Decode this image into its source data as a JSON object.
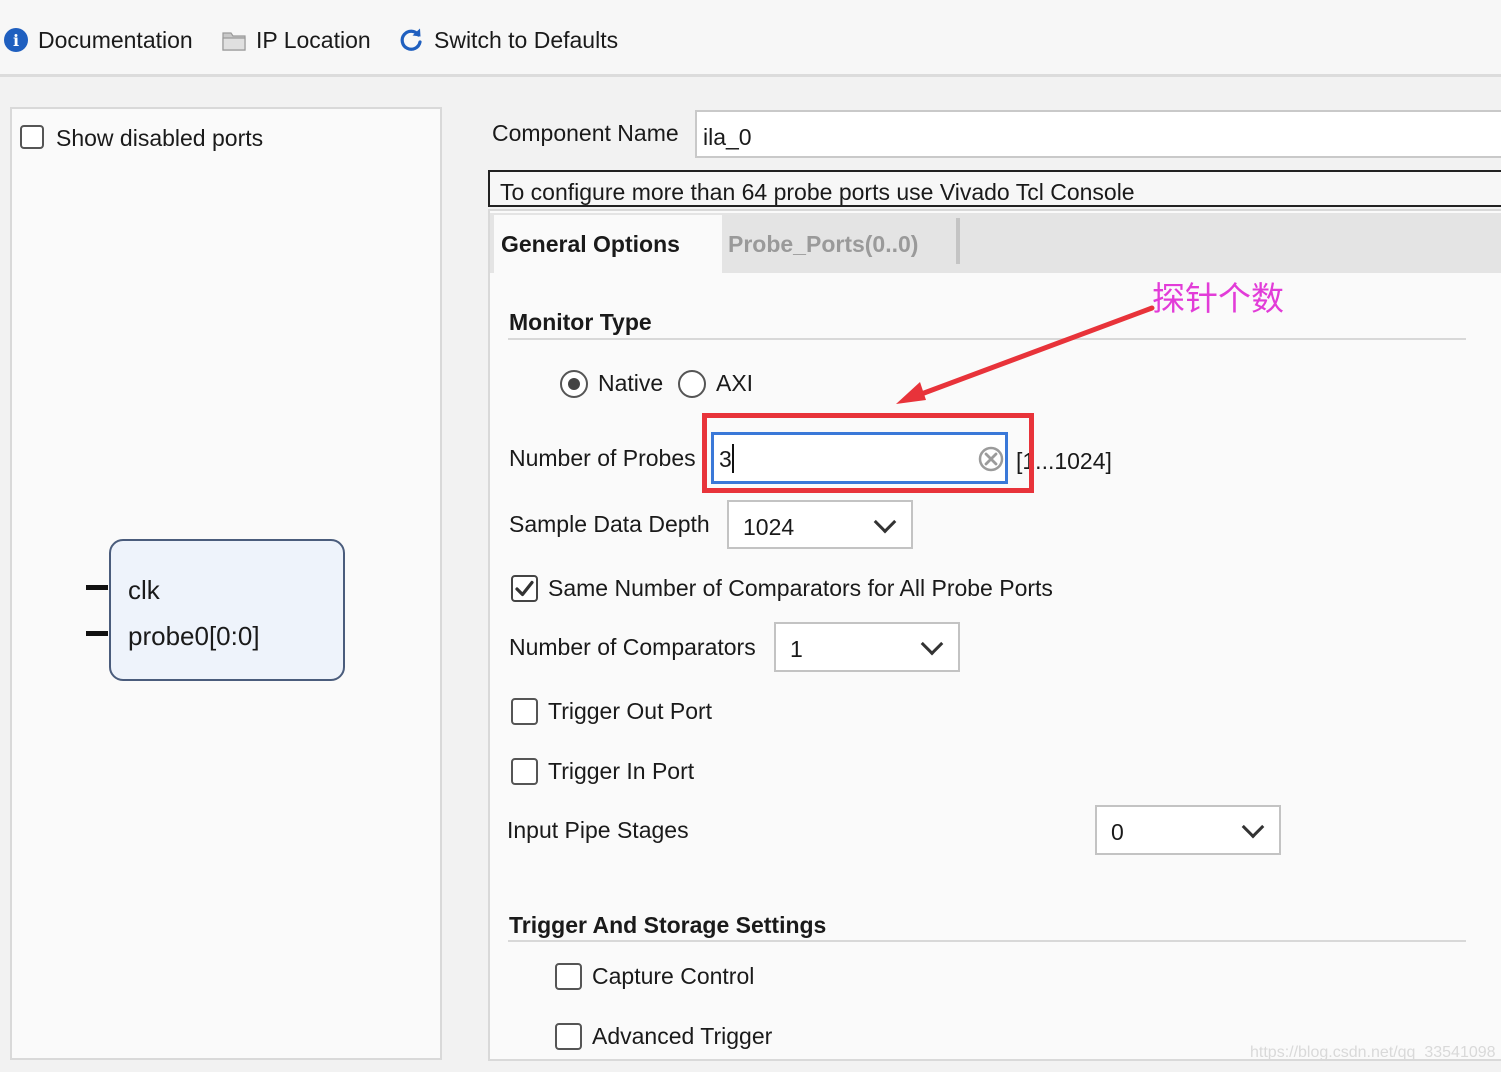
{
  "toolbar": {
    "documentation": "Documentation",
    "ip_location": "IP Location",
    "switch_defaults": "Switch to Defaults"
  },
  "left": {
    "show_disabled_ports": "Show disabled ports",
    "show_disabled_checked": false,
    "block_ports": [
      "clk",
      "probe0[0:0]"
    ]
  },
  "component": {
    "label": "Component Name",
    "value": "ila_0",
    "notice": "To configure more than 64 probe ports use Vivado Tcl Console"
  },
  "tabs": [
    "General Options",
    "Probe_Ports(0..0)"
  ],
  "monitor": {
    "title": "Monitor Type",
    "native": "Native",
    "axi": "AXI",
    "selected": "Native"
  },
  "probes": {
    "label": "Number of Probes",
    "value": "3",
    "range": "[1...1024]"
  },
  "depth": {
    "label": "Sample Data Depth",
    "value": "1024"
  },
  "same_comparators": {
    "label": "Same Number of Comparators for All Probe Ports",
    "checked": true
  },
  "comparators": {
    "label": "Number of Comparators",
    "value": "1"
  },
  "trigger_out": {
    "label": "Trigger Out Port",
    "checked": false
  },
  "trigger_in": {
    "label": "Trigger In Port",
    "checked": false
  },
  "pipe": {
    "label": "Input Pipe Stages",
    "value": "0"
  },
  "storage": {
    "title": "Trigger And Storage Settings",
    "capture": "Capture Control",
    "advanced": "Advanced Trigger"
  },
  "annotation": {
    "text": "探针个数",
    "color": "#e23cd8",
    "box_color": "#e8333a"
  },
  "watermark": "https://blog.csdn.net/qq_33541098",
  "colors": {
    "accent": "#3a78d8",
    "icon_blue": "#1f5fbf"
  }
}
